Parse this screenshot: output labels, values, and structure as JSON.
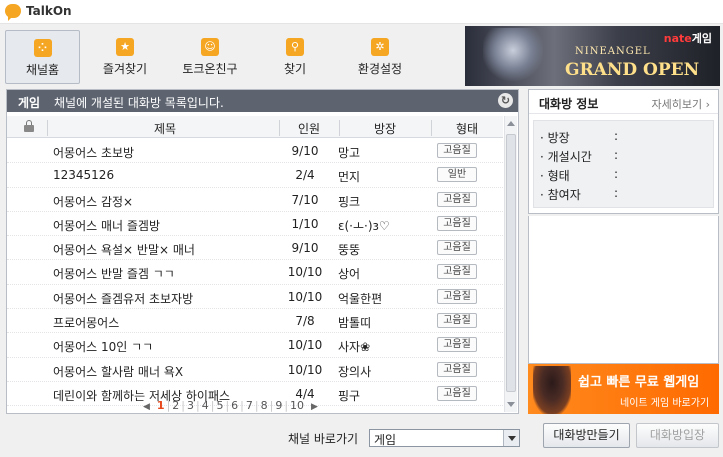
{
  "app": {
    "title": "TalkOn"
  },
  "toolbar": [
    {
      "label": "채널홈",
      "icon": "channel-home-icon",
      "color": "#f5a623",
      "glyph": "⁘"
    },
    {
      "label": "즐겨찾기",
      "icon": "star-icon",
      "color": "#f5a623",
      "glyph": "★"
    },
    {
      "label": "토크온친구",
      "icon": "smiley-icon",
      "color": "#f5a623",
      "glyph": "☺"
    },
    {
      "label": "찾기",
      "icon": "search-icon",
      "color": "#f5a623",
      "glyph": "⚲"
    },
    {
      "label": "환경설정",
      "icon": "gear-icon",
      "color": "#f5a623",
      "glyph": "✲"
    }
  ],
  "banner_top": {
    "brand": "nate",
    "brand_suffix": "게임",
    "subtitle": "NINEANGEL",
    "headline": "GRAND OPEN"
  },
  "panel": {
    "category": "게임",
    "description": "채널에 개설된 대화방 목록입니다."
  },
  "columns": {
    "title": "제목",
    "count": "인원",
    "owner": "방장",
    "type": "형태"
  },
  "rooms": [
    {
      "name": "어몽어스 초보방",
      "count": "9/10",
      "owner": "망고",
      "type": "고음질"
    },
    {
      "name": "12345126",
      "count": "2/4",
      "owner": "먼지",
      "type": "일반"
    },
    {
      "name": "어몽어스 감정×",
      "count": "7/10",
      "owner": "핑크",
      "type": "고음질"
    },
    {
      "name": "어몽어스 매너 즐겜방",
      "count": "1/10",
      "owner": "ε(·ㅗ·)з♡",
      "type": "고음질"
    },
    {
      "name": "어몽어스 욕설× 반말× 매너",
      "count": "9/10",
      "owner": "뚱뚱",
      "type": "고음질"
    },
    {
      "name": "어몽어스 반말 즐겜 ㄱㄱ",
      "count": "10/10",
      "owner": "상어",
      "type": "고음질"
    },
    {
      "name": "어몽어스 즐겜유저 초보자방",
      "count": "10/10",
      "owner": "억울한편",
      "type": "고음질"
    },
    {
      "name": "프로어몽어스",
      "count": "7/8",
      "owner": "밤톨띠",
      "type": "고음질"
    },
    {
      "name": "어몽어스 10인 ㄱㄱ",
      "count": "10/10",
      "owner": "사자❀",
      "type": "고음질"
    },
    {
      "name": "어몽어스 할사람 매너 욕X",
      "count": "10/10",
      "owner": "장의사",
      "type": "고음질"
    },
    {
      "name": "데린이와 함께하는 저세상 하이패스",
      "count": "4/4",
      "owner": "핑구",
      "type": "고음질"
    }
  ],
  "pager": {
    "current": "1",
    "pages": [
      "1",
      "2",
      "3",
      "4",
      "5",
      "6",
      "7",
      "8",
      "9",
      "10"
    ],
    "prev": "◀",
    "next": "▶"
  },
  "info": {
    "title": "대화방 정보",
    "more": "자세히보기",
    "fields": [
      "방장",
      "개설시간",
      "형태",
      "참여자"
    ],
    "colon": ":"
  },
  "ad_bottom": {
    "main": "쉽고 빠른 무료 웹게임",
    "sub": "네이트 게임 바로가기"
  },
  "channel_jump": {
    "label": "채널 바로가기",
    "value": "게임"
  },
  "buttons": {
    "create": "대화방만들기",
    "enter": "대화방입장"
  }
}
